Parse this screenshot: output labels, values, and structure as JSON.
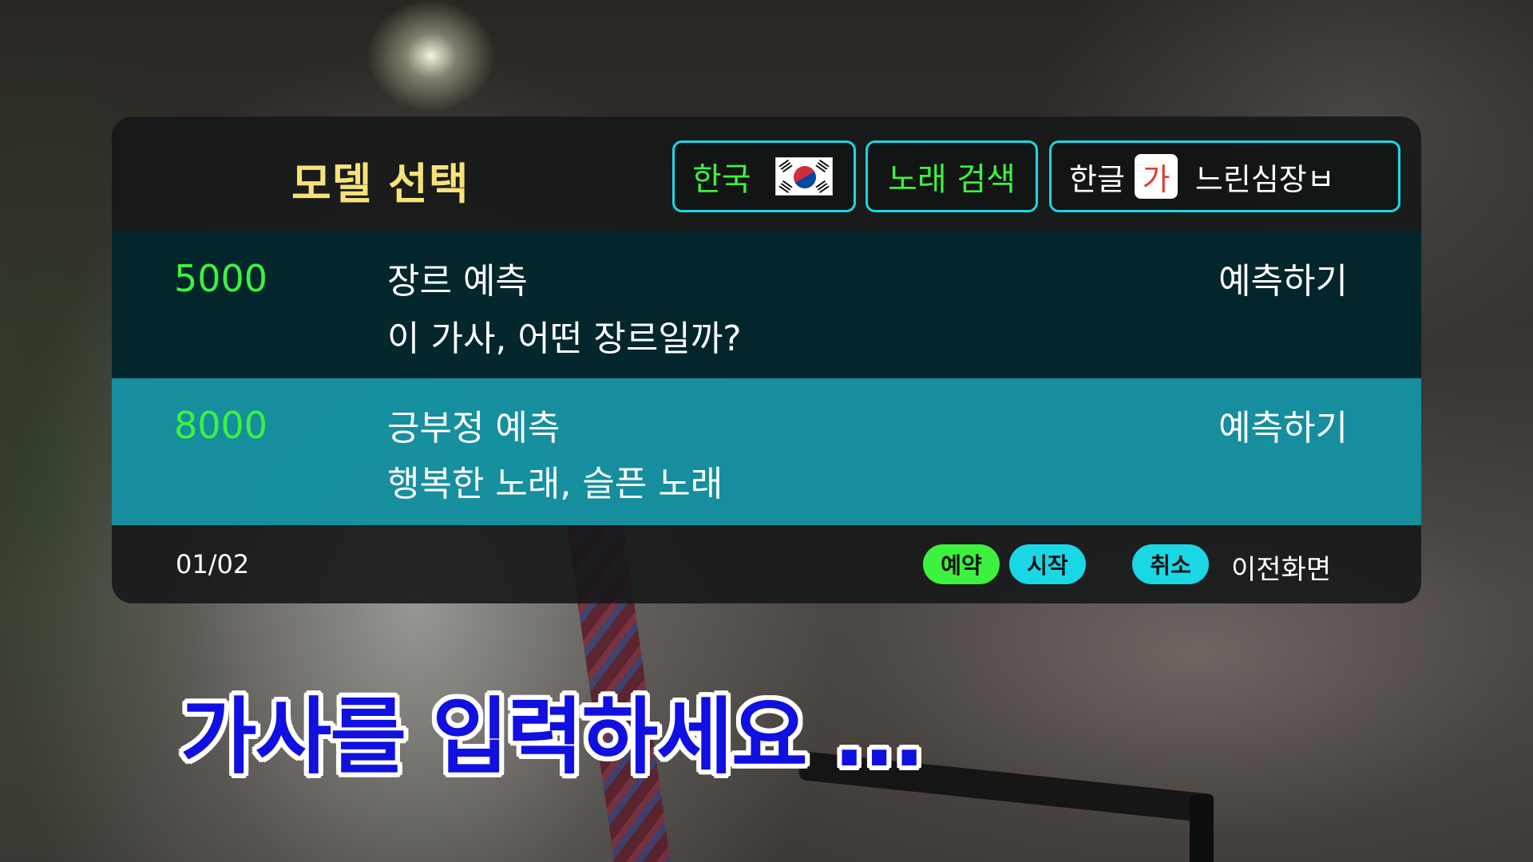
{
  "header": {
    "title": "모델 선택",
    "country_label": "한국",
    "country_flag_icon": "korea-flag-icon",
    "song_search_label": "노래 검색",
    "input_mode_label": "한글",
    "input_mode_char": "가",
    "input_text": "느린심장ㅂ"
  },
  "models": [
    {
      "price": "5000",
      "name": "장르 예측",
      "description": "이 가사, 어떤 장르일까?",
      "action": "예측하기",
      "selected": false
    },
    {
      "price": "8000",
      "name": "긍부정 예측",
      "description": "행복한 노래, 슬픈 노래",
      "action": "예측하기",
      "selected": true
    }
  ],
  "footer": {
    "page_indicator": "01/02",
    "reserve_label": "예약",
    "start_label": "시작",
    "cancel_label": "취소",
    "previous_label": "이전화면"
  },
  "prompt": {
    "lyrics_prompt": "가사를 입력하세요 ..."
  },
  "colors": {
    "title": "#f7e27a",
    "accent_green": "#3df23f",
    "accent_cyan": "#1ad7e6",
    "selected_row": "#169eb0",
    "prompt_blue": "#1010e0"
  }
}
